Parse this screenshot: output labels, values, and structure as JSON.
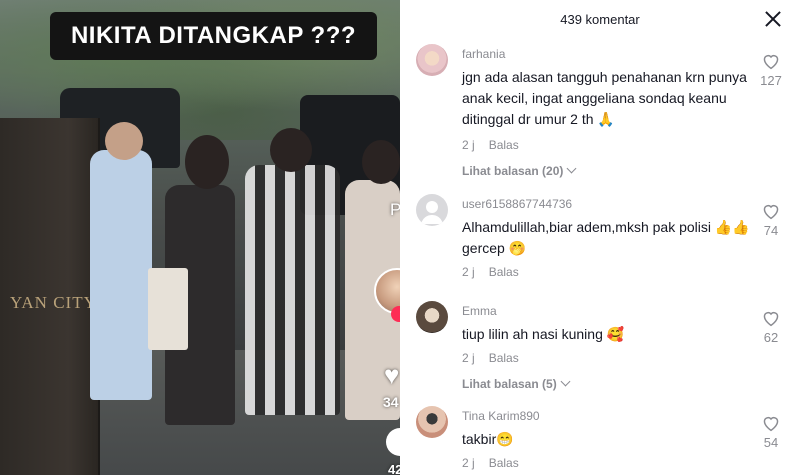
{
  "video": {
    "overlay_title": "NIKITA DITANGKAP ???",
    "sign_text": "YAN CITY",
    "like_count": "34",
    "comment_count": "42",
    "side_letter": "P"
  },
  "comments_panel": {
    "title": "439 komentar",
    "reply_label": "Balas",
    "comments": [
      {
        "username": "farhania",
        "text": "jgn ada alasan tangguh penahanan krn punya anak kecil, ingat anggeliana sondaq keanu ditinggal dr umur 2 th 🙏",
        "time": "2 j",
        "likes": "127",
        "view_replies": "Lihat balasan (20)"
      },
      {
        "username": "user6158867744736",
        "text": "Alhamdulillah,biar adem,mksh pak polisi 👍👍gercep 🤭",
        "time": "2 j",
        "likes": "74"
      },
      {
        "username": "Emma",
        "text": "tiup lilin ah nasi kuning 🥰",
        "time": "2 j",
        "likes": "62",
        "view_replies": "Lihat balasan (5)"
      },
      {
        "username": "Tina Karim890",
        "text": "takbir😁",
        "time": "2 j",
        "likes": "54"
      }
    ]
  }
}
